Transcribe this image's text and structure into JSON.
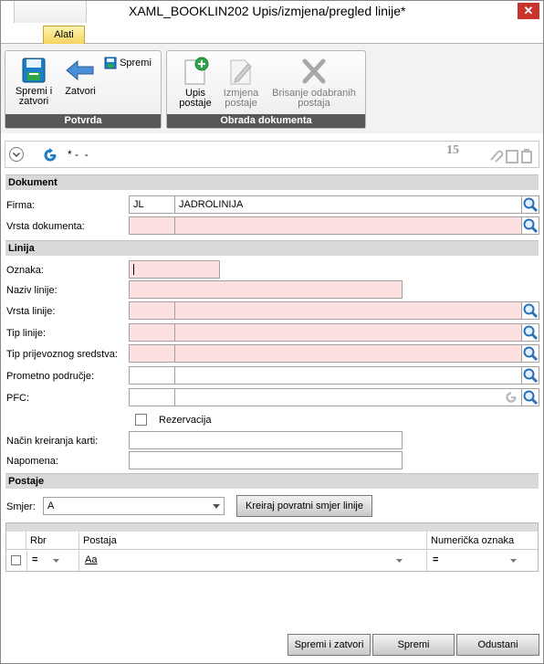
{
  "window": {
    "title": "XAML_BOOKLIN202  Upis/izmjena/pregled linije*",
    "close_glyph": "✕"
  },
  "ribbon": {
    "tab": "Alati",
    "groups": [
      {
        "label": "Potvrda",
        "buttons": [
          {
            "label_line1": "Spremi i",
            "label_line2": "zatvori",
            "icon": "save-close-icon"
          },
          {
            "label_line1": "Zatvori",
            "label_line2": "",
            "icon": "back-arrow-icon"
          },
          {
            "label_line1": "Spremi",
            "label_line2": "",
            "icon": "save-icon"
          }
        ]
      },
      {
        "label": "Obrada dokumenta",
        "buttons": [
          {
            "label_line1": "Upis",
            "label_line2": "postaje",
            "icon": "new-document-icon"
          },
          {
            "label_line1": "Izmjena",
            "label_line2": "postaje",
            "icon": "edit-document-icon"
          },
          {
            "label_line1": "Brisanje odabranih",
            "label_line2": "postaja",
            "icon": "delete-x-icon"
          }
        ]
      }
    ]
  },
  "record_bar": {
    "title_text": "* -  -",
    "counter": "15"
  },
  "sections": {
    "dokument": "Dokument",
    "linija": "Linija",
    "postaje": "Postaje"
  },
  "fields": {
    "firma": {
      "label": "Firma:",
      "code": "JL",
      "name": "JADROLINIJA"
    },
    "vrsta_dokumenta": {
      "label": "Vrsta dokumenta:",
      "code": "",
      "name": ""
    },
    "oznaka": {
      "label": "Oznaka:",
      "value": ""
    },
    "naziv_linije": {
      "label": "Naziv linije:",
      "value": ""
    },
    "vrsta_linije": {
      "label": "Vrsta linije:",
      "code": "",
      "name": ""
    },
    "tip_linije": {
      "label": "Tip linije:",
      "code": "",
      "name": ""
    },
    "tip_prijevoznog_sredstva": {
      "label": "Tip prijevoznog sredstva:",
      "code": "",
      "name": ""
    },
    "prometno_podrucje": {
      "label": "Prometno područje:",
      "code": "",
      "name": ""
    },
    "pfc": {
      "label": "PFC:",
      "code": "",
      "name": ""
    },
    "rezervacija": {
      "label": "Rezervacija",
      "checked": false
    },
    "nacin_kreiranja_karti": {
      "label": "Način kreiranja karti:",
      "value": ""
    },
    "napomena": {
      "label": "Napomena:",
      "value": ""
    }
  },
  "postaje": {
    "smjer_label": "Smjer:",
    "smjer_value": "A",
    "kreiraj_button": "Kreiraj povratni smjer linije",
    "columns": [
      "Rbr",
      "Postaja",
      "Numerička oznaka"
    ],
    "filter_row": {
      "rbr_op": "=",
      "postaja_op": "Aa",
      "numericka_op": "="
    }
  },
  "footer": {
    "spremi_zatvori": "Spremi i zatvori",
    "spremi": "Spremi",
    "odustani": "Odustani"
  }
}
